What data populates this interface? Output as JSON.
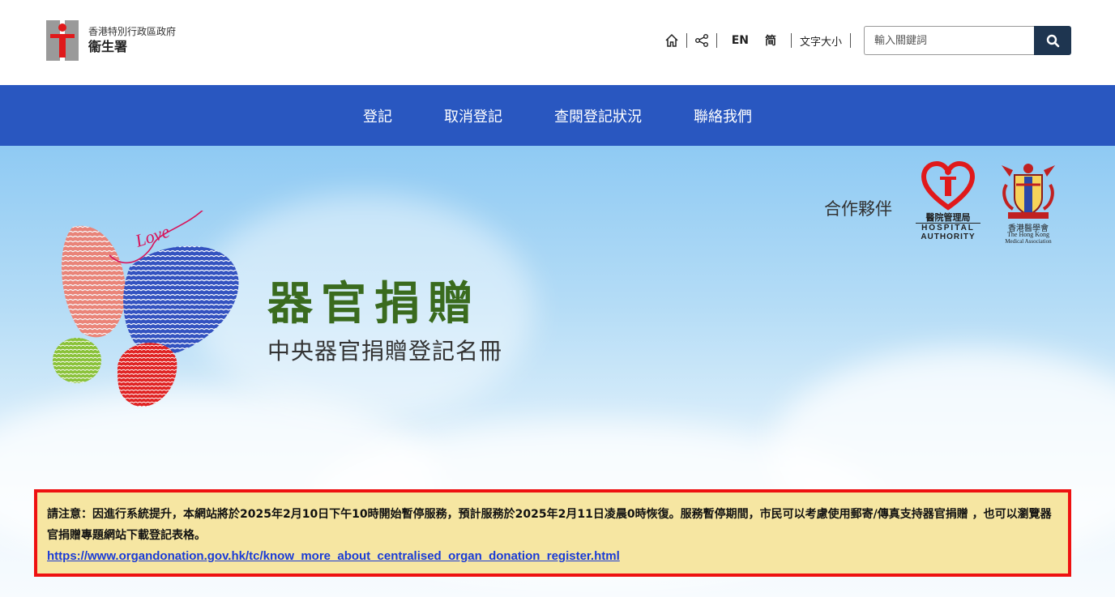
{
  "header": {
    "gov_label": "香港特別行政區政府",
    "dept_label": "衞生署",
    "lang_en": "EN",
    "lang_sc": "简",
    "font_size": "文字大小",
    "search_placeholder": "輸入關鍵詞"
  },
  "nav": {
    "items": [
      {
        "label": "登記"
      },
      {
        "label": "取消登記"
      },
      {
        "label": "查閱登記狀況"
      },
      {
        "label": "聯絡我們"
      }
    ]
  },
  "hero": {
    "partner_label": "合作夥伴",
    "title": "器官捐贈",
    "subtitle": "中央器官捐贈登記名冊",
    "love_script": "Love",
    "ha_logo": {
      "zh": "醫院管理局",
      "en1": "HOSPITAL",
      "en2": "AUTHORITY"
    },
    "hkma_logo": {
      "zh": "香港醫學會",
      "en1": "The Hong Kong",
      "en2": "Medical Association"
    }
  },
  "notice": {
    "text": "請注意：因進行系統提升，本網站將於2025年2月10日下午10時開始暫停服務，預計服務於2025年2月11日凌晨0時恢復。服務暫停期間，市民可以考慮使用郵寄/傳真支持器官捐贈 ，也可以瀏覽器官捐贈專題網站下載登記表格。",
    "link": "https://www.organdonation.gov.hk/tc/know_more_about_centralised_organ_donation_register.html"
  },
  "colors": {
    "nav_bg": "#2957c0",
    "search_btn": "#1e3550",
    "title_green": "#3a6b1e",
    "notice_bg": "#f6e6a2",
    "notice_border": "#ee1111",
    "link": "#1a3bd6"
  }
}
